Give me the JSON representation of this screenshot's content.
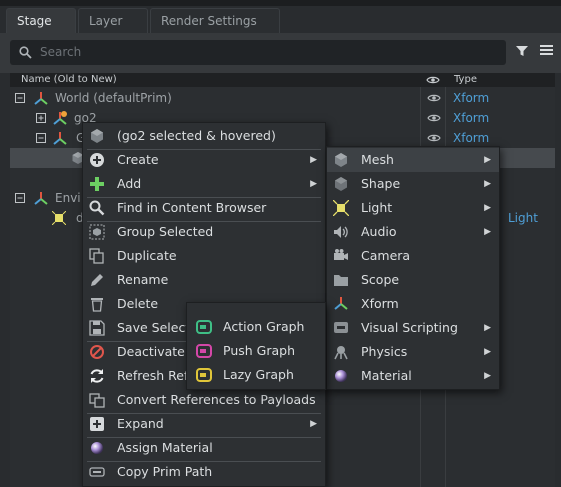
{
  "tabs": [
    {
      "label": "Stage"
    },
    {
      "label": "Layer"
    },
    {
      "label": "Render Settings"
    }
  ],
  "search": {
    "placeholder": "Search"
  },
  "columns": {
    "name": "Name (Old to New)",
    "type": "Type"
  },
  "tree": {
    "rows": [
      {
        "label": "World (defaultPrim)",
        "type": "Xform"
      },
      {
        "label": "go2",
        "type": "Xform"
      },
      {
        "label": "G",
        "type": "Xform"
      },
      {
        "label": "Envi",
        "type": ""
      },
      {
        "label": "d",
        "type": "Light"
      }
    ]
  },
  "context_menu": {
    "title": "(go2 selected & hovered)",
    "items": [
      {
        "label": "Create",
        "submenu": true
      },
      {
        "label": "Add",
        "submenu": true
      },
      {
        "label": "Find in Content Browser"
      },
      {
        "label": "Group Selected"
      },
      {
        "label": "Duplicate"
      },
      {
        "label": "Rename"
      },
      {
        "label": "Delete"
      },
      {
        "label": "Save Selected"
      },
      {
        "label": "Deactivate"
      },
      {
        "label": "Refresh Ref"
      },
      {
        "label": "Convert References to Payloads"
      },
      {
        "label": "Expand",
        "submenu": true
      },
      {
        "label": "Assign Material"
      },
      {
        "label": "Copy Prim Path"
      }
    ]
  },
  "create_submenu": {
    "items": [
      {
        "label": "Mesh",
        "submenu": true
      },
      {
        "label": "Shape",
        "submenu": true
      },
      {
        "label": "Light",
        "submenu": true
      },
      {
        "label": "Audio",
        "submenu": true
      },
      {
        "label": "Camera"
      },
      {
        "label": "Scope"
      },
      {
        "label": "Xform"
      },
      {
        "label": "Visual Scripting",
        "submenu": true
      },
      {
        "label": "Physics",
        "submenu": true
      },
      {
        "label": "Material",
        "submenu": true
      }
    ]
  },
  "visual_scripting_submenu": {
    "items": [
      {
        "label": "Action Graph"
      },
      {
        "label": "Push Graph"
      },
      {
        "label": "Lazy Graph"
      }
    ]
  },
  "colors": {
    "accent_blue": "#4f9fd6",
    "xform_red": "#e0563f",
    "xform_green": "#6ccf62",
    "highlight": "#3d4145"
  }
}
